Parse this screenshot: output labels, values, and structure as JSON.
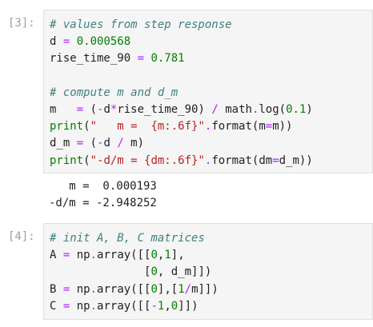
{
  "cell3": {
    "prompt": "[3]:",
    "lines": [
      [
        {
          "t": "cm",
          "v": "# values from step response"
        }
      ],
      [
        {
          "t": "tx",
          "v": "d "
        },
        {
          "t": "op",
          "v": "="
        },
        {
          "t": "tx",
          "v": " "
        },
        {
          "t": "num",
          "v": "0.000568"
        }
      ],
      [
        {
          "t": "tx",
          "v": "rise_time_90 "
        },
        {
          "t": "op",
          "v": "="
        },
        {
          "t": "tx",
          "v": " "
        },
        {
          "t": "num",
          "v": "0.781"
        }
      ],
      [],
      [
        {
          "t": "cm",
          "v": "# compute m and d_m"
        }
      ],
      [
        {
          "t": "tx",
          "v": "m   "
        },
        {
          "t": "op",
          "v": "="
        },
        {
          "t": "tx",
          "v": " ("
        },
        {
          "t": "op",
          "v": "-"
        },
        {
          "t": "tx",
          "v": "d"
        },
        {
          "t": "op",
          "v": "*"
        },
        {
          "t": "tx",
          "v": "rise_time_90) "
        },
        {
          "t": "op",
          "v": "/"
        },
        {
          "t": "tx",
          "v": " math"
        },
        {
          "t": "op",
          "v": "."
        },
        {
          "t": "tx",
          "v": "log("
        },
        {
          "t": "num",
          "v": "0.1"
        },
        {
          "t": "tx",
          "v": ")"
        }
      ],
      [
        {
          "t": "bi",
          "v": "print"
        },
        {
          "t": "tx",
          "v": "("
        },
        {
          "t": "str",
          "v": "\"   m =  {m:.6f}\""
        },
        {
          "t": "op",
          "v": "."
        },
        {
          "t": "tx",
          "v": "format(m"
        },
        {
          "t": "op",
          "v": "="
        },
        {
          "t": "tx",
          "v": "m))"
        }
      ],
      [
        {
          "t": "tx",
          "v": "d_m "
        },
        {
          "t": "op",
          "v": "="
        },
        {
          "t": "tx",
          "v": " ("
        },
        {
          "t": "op",
          "v": "-"
        },
        {
          "t": "tx",
          "v": "d "
        },
        {
          "t": "op",
          "v": "/"
        },
        {
          "t": "tx",
          "v": " m)"
        }
      ],
      [
        {
          "t": "bi",
          "v": "print"
        },
        {
          "t": "tx",
          "v": "("
        },
        {
          "t": "str",
          "v": "\"-d/m = {dm:.6f}\""
        },
        {
          "t": "op",
          "v": "."
        },
        {
          "t": "tx",
          "v": "format(dm"
        },
        {
          "t": "op",
          "v": "="
        },
        {
          "t": "tx",
          "v": "d_m))"
        }
      ]
    ],
    "output_lines": [
      "   m =  0.000193",
      "-d/m = -2.948252"
    ]
  },
  "cell4": {
    "prompt": "[4]:",
    "lines": [
      [
        {
          "t": "cm",
          "v": "# init A, B, C matrices"
        }
      ],
      [
        {
          "t": "tx",
          "v": "A "
        },
        {
          "t": "op",
          "v": "="
        },
        {
          "t": "tx",
          "v": " np"
        },
        {
          "t": "op",
          "v": "."
        },
        {
          "t": "tx",
          "v": "array([["
        },
        {
          "t": "num",
          "v": "0"
        },
        {
          "t": "tx",
          "v": ","
        },
        {
          "t": "num",
          "v": "1"
        },
        {
          "t": "tx",
          "v": "],"
        }
      ],
      [
        {
          "t": "tx",
          "v": "              ["
        },
        {
          "t": "num",
          "v": "0"
        },
        {
          "t": "tx",
          "v": ", d_m]])"
        }
      ],
      [
        {
          "t": "tx",
          "v": "B "
        },
        {
          "t": "op",
          "v": "="
        },
        {
          "t": "tx",
          "v": " np"
        },
        {
          "t": "op",
          "v": "."
        },
        {
          "t": "tx",
          "v": "array([["
        },
        {
          "t": "num",
          "v": "0"
        },
        {
          "t": "tx",
          "v": "],["
        },
        {
          "t": "num",
          "v": "1"
        },
        {
          "t": "op",
          "v": "/"
        },
        {
          "t": "tx",
          "v": "m]])"
        }
      ],
      [
        {
          "t": "tx",
          "v": "C "
        },
        {
          "t": "op",
          "v": "="
        },
        {
          "t": "tx",
          "v": " np"
        },
        {
          "t": "op",
          "v": "."
        },
        {
          "t": "tx",
          "v": "array([["
        },
        {
          "t": "op",
          "v": "-"
        },
        {
          "t": "num",
          "v": "1"
        },
        {
          "t": "tx",
          "v": ","
        },
        {
          "t": "num",
          "v": "0"
        },
        {
          "t": "tx",
          "v": "]])"
        }
      ]
    ]
  }
}
